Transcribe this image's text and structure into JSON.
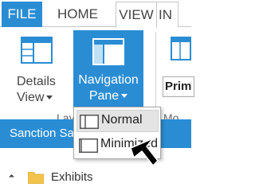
{
  "tabs": {
    "file": "FILE",
    "home": "HOME",
    "view": "VIEW",
    "insert_partial": "IN"
  },
  "ribbon": {
    "details_view": {
      "line1": "Details",
      "line2": "View"
    },
    "navigation_pane": {
      "line1": "Navigation",
      "line2": "Pane"
    },
    "layout_group_partial": "Lay",
    "more_group_partial": "Mo",
    "primary_partial": "Prim"
  },
  "dropdown": {
    "items": [
      "Normal",
      "Minimized"
    ],
    "selected": "Normal"
  },
  "content": {
    "header_partial": "Sanction Sa",
    "tree_item": "Exhibits"
  },
  "colors": {
    "accent": "#2a8dd4",
    "folder": "#f2c44d"
  },
  "icons": [
    "details-view-icon",
    "navigation-pane-icon",
    "pane-normal-icon",
    "pane-minimized-icon",
    "folder-icon",
    "expand-arrow-icon"
  ]
}
